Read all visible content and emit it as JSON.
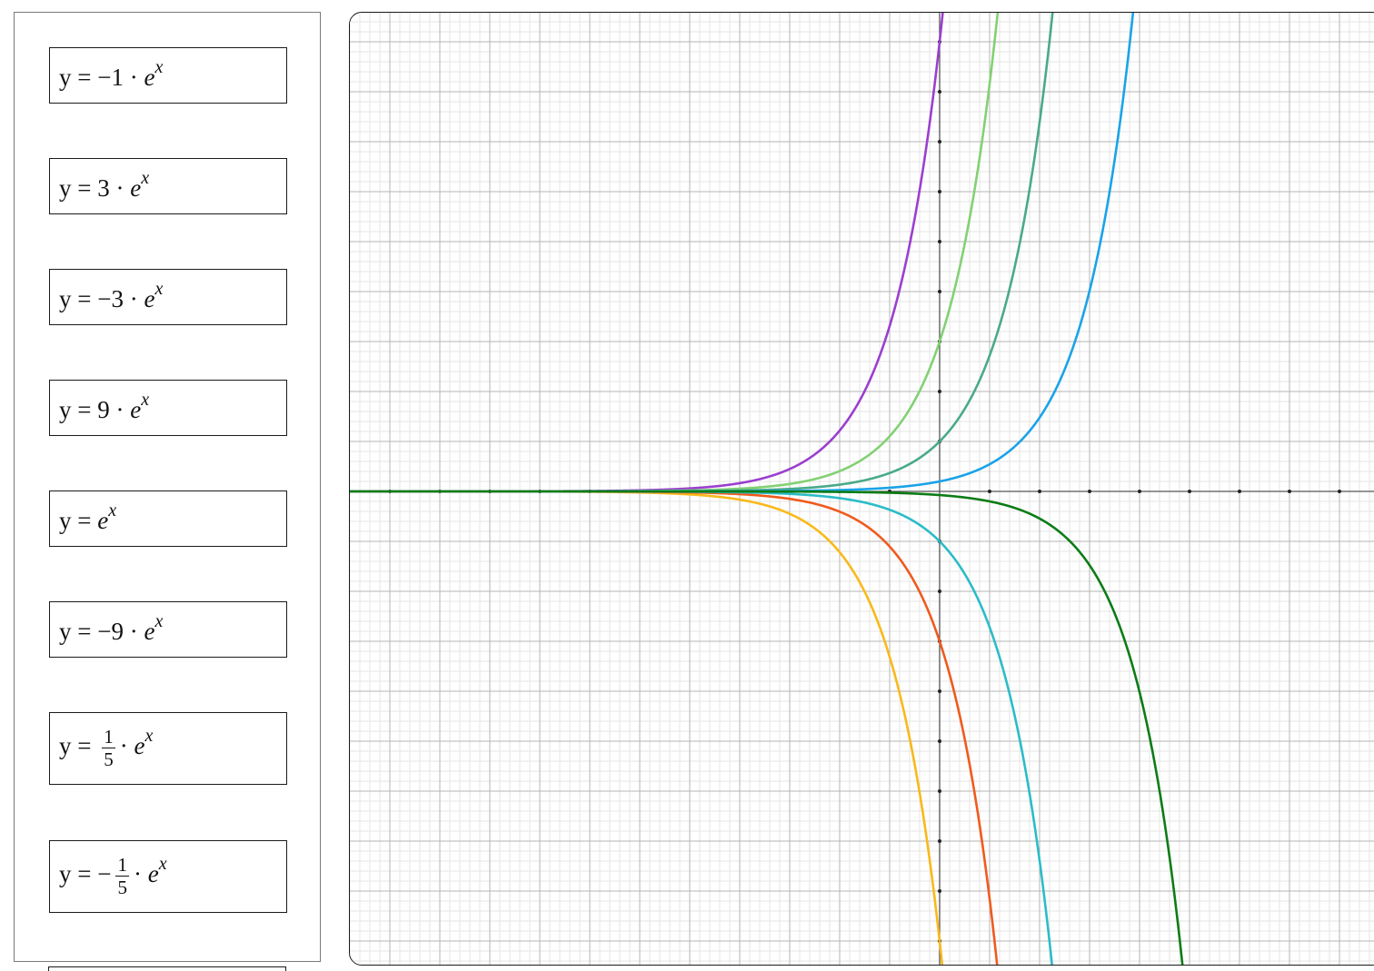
{
  "formula_cards": [
    {
      "id": "card-1",
      "kind": "simple",
      "prefix": "y = −1 · ",
      "base": "e",
      "exp": "x"
    },
    {
      "id": "card-2",
      "kind": "simple",
      "prefix": "y = 3 · ",
      "base": "e",
      "exp": "x"
    },
    {
      "id": "card-3",
      "kind": "simple",
      "prefix": "y = −3 · ",
      "base": "e",
      "exp": "x"
    },
    {
      "id": "card-4",
      "kind": "simple",
      "prefix": "y = 9 · ",
      "base": "e",
      "exp": "x"
    },
    {
      "id": "card-5",
      "kind": "simple",
      "prefix": "y = ",
      "base": "e",
      "exp": "x"
    },
    {
      "id": "card-6",
      "kind": "simple",
      "prefix": "y = −9 · ",
      "base": "e",
      "exp": "x"
    },
    {
      "id": "card-7",
      "kind": "fraction",
      "prefix": "y = ",
      "num": "1",
      "den": "5",
      "suffix": "· ",
      "base": "e",
      "exp": "x"
    },
    {
      "id": "card-8",
      "kind": "fraction",
      "prefix": "y = −",
      "num": "1",
      "den": "5",
      "suffix": "· ",
      "base": "e",
      "exp": "x"
    }
  ],
  "chart_data": {
    "type": "line",
    "title": "",
    "xlabel": "",
    "ylabel": "",
    "xlim": [
      -11.8,
      8.6
    ],
    "ylim": [
      -9.5,
      9.5
    ],
    "grid": true,
    "axis_ticks": "dots at integer values, no tick labels",
    "series": [
      {
        "function": "y = 9·e^x",
        "coefficient": 9,
        "shift": 0,
        "color": "#9b3fcf"
      },
      {
        "function": "y = 3·e^x",
        "coefficient": 3,
        "shift": 0,
        "color": "#82d173"
      },
      {
        "function": "y = 1·e^x",
        "coefficient": 1,
        "shift": 0,
        "color": "#4aaa88"
      },
      {
        "function": "y = 0.2·e^x",
        "coefficient": 0.2,
        "shift": 0,
        "color": "#1aa3e8"
      },
      {
        "function": "y = -9·e^x",
        "coefficient": -9,
        "shift": 0,
        "color": "#f9b91a"
      },
      {
        "function": "y = -3·e^x",
        "coefficient": -3,
        "shift": 0,
        "color": "#f05a1e"
      },
      {
        "function": "y = -1·e^x",
        "coefficient": -1,
        "shift": 0,
        "color": "#2bbcc8"
      },
      {
        "function": "y = -0.2·e^(x-1)",
        "coefficient": -0.2,
        "shift": 1,
        "color": "#0c7c16"
      }
    ]
  }
}
